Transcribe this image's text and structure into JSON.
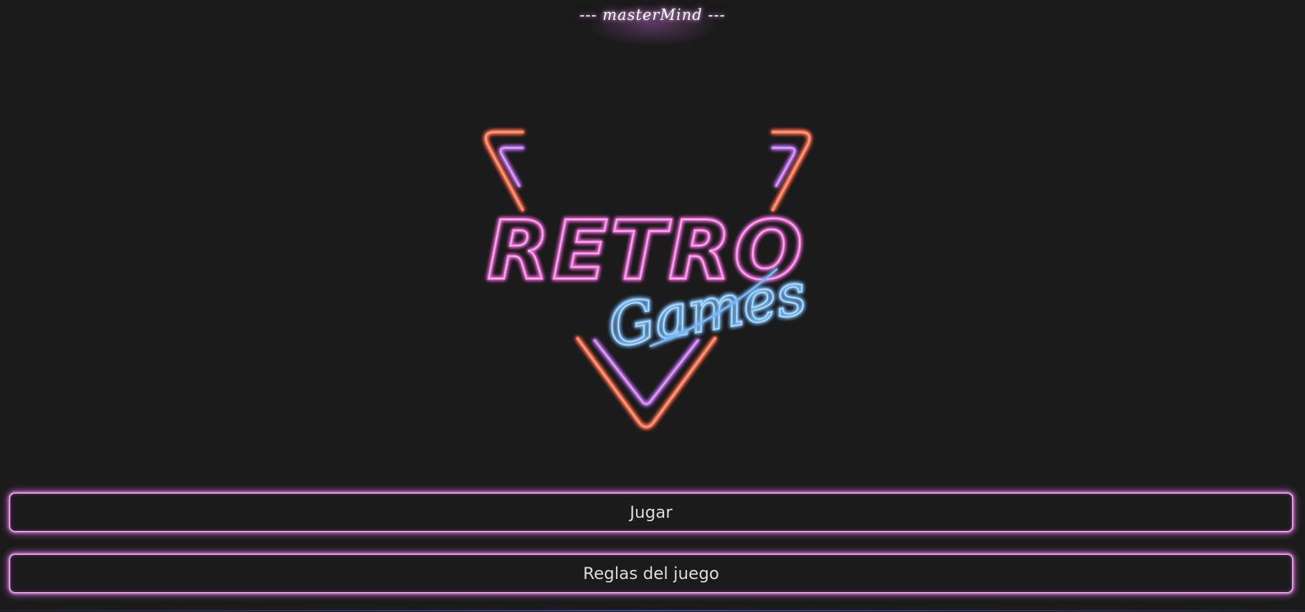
{
  "header": {
    "title": "--- masterMind ---"
  },
  "logo": {
    "main_text": "RETRO",
    "sub_text": "Games",
    "colors": {
      "orange": "#ff6a4a",
      "violet": "#b76ae8",
      "pink": "#f46ad8",
      "blue": "#7ab8f5"
    }
  },
  "menu": {
    "play_label": "Jugar",
    "rules_label": "Reglas del juego"
  },
  "theme": {
    "background": "#1b1b1b",
    "button_glow": "#e79ae9"
  }
}
